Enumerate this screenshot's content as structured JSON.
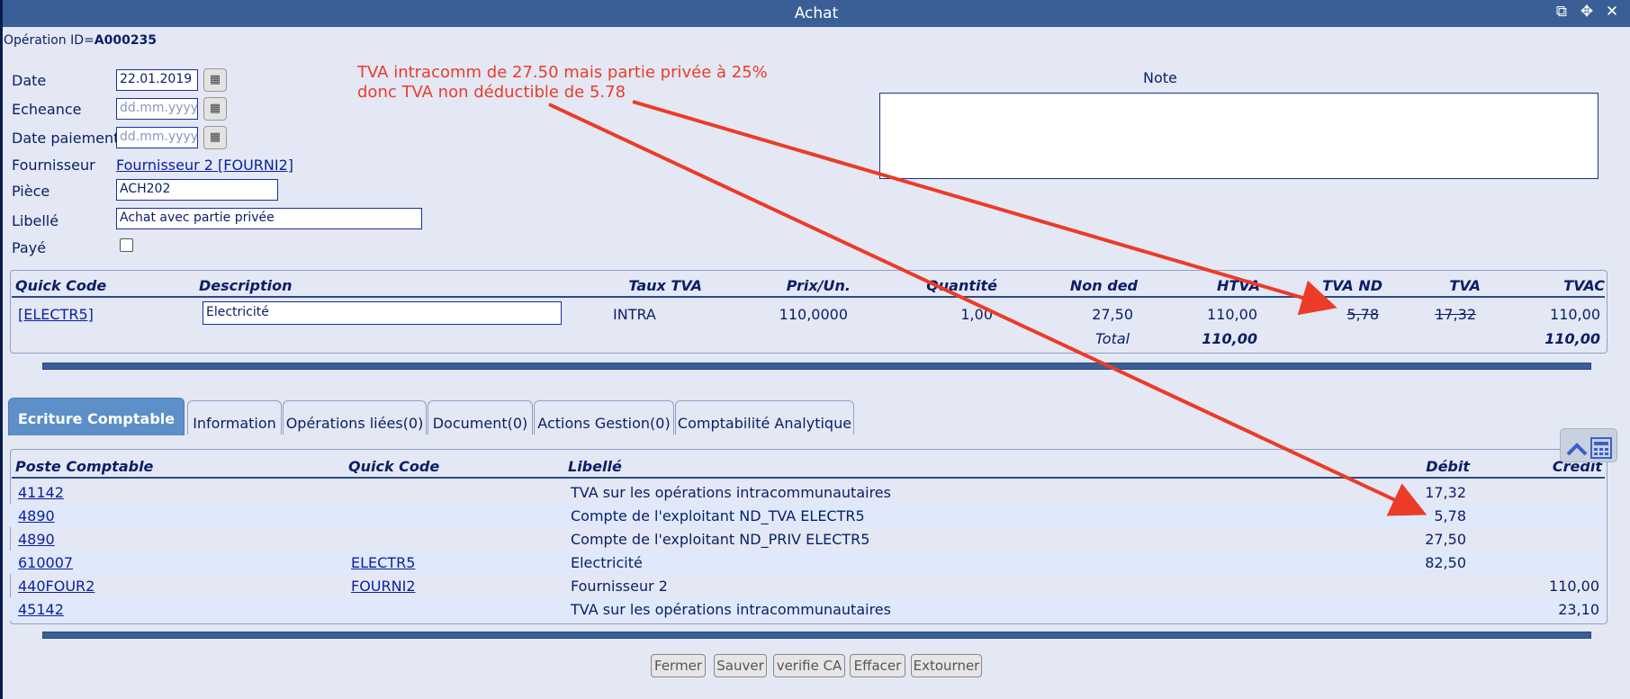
{
  "window": {
    "title": "Achat",
    "icons": [
      "external-link-icon",
      "move-icon",
      "close-icon"
    ]
  },
  "operation": {
    "label": "Opération ID=",
    "id": "A000235"
  },
  "form": {
    "date_label": "Date",
    "date_value": "22.01.2019",
    "echeance_label": "Echeance",
    "echeance_placeholder": "dd.mm.yyyy",
    "date_paiement_label": "Date paiement",
    "date_paiement_placeholder": "dd.mm.yyyy",
    "fournisseur_label": "Fournisseur",
    "fournisseur_value": "Fournisseur 2 [FOURNI2]",
    "piece_label": "Pièce",
    "piece_value": "ACH202",
    "libelle_label": "Libellé",
    "libelle_value": "Achat avec partie privée",
    "paye_label": "Payé",
    "paye_checked": false
  },
  "note": {
    "label": "Note",
    "value": ""
  },
  "annotation": {
    "line1": "TVA intracomm de 27.50 mais partie privée à 25%",
    "line2": "donc TVA non déductible de 5.78",
    "color": "#ec3b28"
  },
  "detail_table": {
    "headers": [
      "Quick Code",
      "Description",
      "Taux TVA",
      "Prix/Un.",
      "Quantité",
      "Non ded",
      "HTVA",
      "TVA ND",
      "TVA",
      "TVAC"
    ],
    "row": {
      "quick_code": "[ELECTR5]",
      "description": "Electricité",
      "taux_tva": "INTRA",
      "prix_un": "110,0000",
      "quantite": "1,00",
      "non_ded": "27,50",
      "htva": "110,00",
      "tva_nd": "5,78",
      "tva": "17,32",
      "tvac": "110,00"
    },
    "total": {
      "label": "Total",
      "htva": "110,00",
      "tvac": "110,00"
    }
  },
  "tabs": [
    {
      "label": "Ecriture Comptable",
      "active": true
    },
    {
      "label": "Information",
      "active": false
    },
    {
      "label": "Opérations liées(0)",
      "active": false
    },
    {
      "label": "Document(0)",
      "active": false
    },
    {
      "label": "Actions Gestion(0)",
      "active": false
    },
    {
      "label": "Comptabilité Analytique",
      "active": false
    }
  ],
  "ledger": {
    "headers": [
      "Poste Comptable",
      "Quick Code",
      "Libellé",
      "Débit",
      "Crédit"
    ],
    "rows": [
      {
        "poste": "41142",
        "quick_code": "",
        "libelle": "TVA sur les opérations intracommunautaires",
        "debit": "17,32",
        "credit": ""
      },
      {
        "poste": "4890",
        "quick_code": "",
        "libelle": "Compte de l'exploitant ND_TVA ELECTR5",
        "debit": "5,78",
        "credit": ""
      },
      {
        "poste": "4890",
        "quick_code": "",
        "libelle": "Compte de l'exploitant ND_PRIV ELECTR5",
        "debit": "27,50",
        "credit": ""
      },
      {
        "poste": "610007",
        "quick_code": "ELECTR5",
        "libelle": "Electricité",
        "debit": "82,50",
        "credit": ""
      },
      {
        "poste": "440FOUR2",
        "quick_code": "FOURNI2",
        "libelle": "Fournisseur 2",
        "debit": "",
        "credit": "110,00"
      },
      {
        "poste": "45142",
        "quick_code": "",
        "libelle": "TVA sur les opérations intracommunautaires",
        "debit": "",
        "credit": "23,10"
      }
    ]
  },
  "buttons": {
    "fermer": "Fermer",
    "sauver": "Sauver",
    "verifie": "verifie CA",
    "effacer": "Effacer",
    "extourner": "Extourner"
  },
  "colors": {
    "titlebar": "#3a5f97",
    "background": "#e3e8f4",
    "text": "#0b1e66",
    "active_tab": "#5d8fc8"
  }
}
